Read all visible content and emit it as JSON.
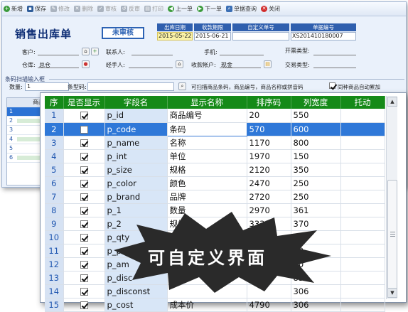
{
  "toolbar": {
    "items": [
      {
        "label": "新增",
        "icon": "add-icon",
        "enabled": true
      },
      {
        "label": "保存",
        "icon": "save-icon",
        "enabled": true
      },
      {
        "label": "修改",
        "icon": "edit-icon",
        "enabled": false
      },
      {
        "label": "删除",
        "icon": "delete-icon",
        "enabled": false
      },
      {
        "label": "审核",
        "icon": "approve-icon",
        "enabled": false
      },
      {
        "label": "反审",
        "icon": "unapprove-icon",
        "enabled": false
      },
      {
        "label": "打印",
        "icon": "print-icon",
        "enabled": false
      },
      {
        "label": "上一单",
        "icon": "prev-icon",
        "enabled": true
      },
      {
        "label": "下一单",
        "icon": "next-icon",
        "enabled": true
      },
      {
        "label": "单据查询",
        "icon": "query-icon",
        "enabled": true
      },
      {
        "label": "关闭",
        "icon": "close-icon",
        "enabled": true
      }
    ]
  },
  "doc": {
    "title": "销售出库单",
    "stamp": "未审核",
    "headers": [
      "出库日期",
      "收款期限",
      "自定义单号",
      "单据编号"
    ],
    "values": [
      "2015-05-22",
      "2015-06-21",
      "",
      "XS201410180007"
    ]
  },
  "form": {
    "customer": "客户:",
    "contact": "联系人:",
    "mobile": "手机:",
    "invoice_type": "开票类型:",
    "warehouse": "仓库:",
    "warehouse_value": "总仓",
    "handler": "经手人:",
    "account": "收款帐户:",
    "account_value": "现金",
    "trade_type": "交易类型:"
  },
  "scan": {
    "section": "条码扫描输入框",
    "qty_label": "数量:",
    "qty_value": "1",
    "barcode_label": "条型码:",
    "hint": "可扫描商品条码，商品编号，商品名称或拼音码",
    "same_merge": "同种商品自动累加"
  },
  "bg_grid": {
    "header": "商品",
    "rows": [
      "1",
      "2",
      "3",
      "4",
      "5",
      "6"
    ]
  },
  "table": {
    "columns": [
      "序",
      "是否显示",
      "字段名",
      "显示名称",
      "排序码",
      "列宽度",
      "托动"
    ],
    "rows": [
      {
        "seq": "1",
        "visible": true,
        "field": "p_id",
        "name": "商品编号",
        "sort": "20",
        "width": "550"
      },
      {
        "seq": "2",
        "visible": false,
        "field": "p_code",
        "name": "条码",
        "sort": "570",
        "width": "600"
      },
      {
        "seq": "3",
        "visible": true,
        "field": "p_name",
        "name": "名称",
        "sort": "1170",
        "width": "800"
      },
      {
        "seq": "4",
        "visible": true,
        "field": "p_int",
        "name": "单位",
        "sort": "1970",
        "width": "150"
      },
      {
        "seq": "5",
        "visible": true,
        "field": "p_size",
        "name": "规格",
        "sort": "2120",
        "width": "350"
      },
      {
        "seq": "6",
        "visible": true,
        "field": "p_color",
        "name": "颜色",
        "sort": "2470",
        "width": "250"
      },
      {
        "seq": "7",
        "visible": true,
        "field": "p_brand",
        "name": "品牌",
        "sort": "2720",
        "width": "250"
      },
      {
        "seq": "8",
        "visible": true,
        "field": "p_1",
        "name": "数量",
        "sort": "2970",
        "width": "361"
      },
      {
        "seq": "9",
        "visible": true,
        "field": "p_2",
        "name": "规格",
        "sort": "3331",
        "width": "370"
      },
      {
        "seq": "10",
        "visible": true,
        "field": "p_qty",
        "name": "",
        "sort": "",
        "width": "300"
      },
      {
        "seq": "11",
        "visible": true,
        "field": "p_pri",
        "name": "",
        "sort": "",
        "width": "00"
      },
      {
        "seq": "12",
        "visible": true,
        "field": "p_am",
        "name": "",
        "sort": "",
        "width": "00"
      },
      {
        "seq": "13",
        "visible": true,
        "field": "p_disc",
        "name": "",
        "sort": "",
        "width": "83"
      },
      {
        "seq": "14",
        "visible": true,
        "field": "p_disconst",
        "name": "",
        "sort": "",
        "width": "306"
      },
      {
        "seq": "15",
        "visible": true,
        "field": "p_cost",
        "name": "成本价",
        "sort": "4790",
        "width": "306"
      }
    ],
    "selected_index": 1
  },
  "banner": {
    "text": "可自定义界面",
    "color": "#2a2a2a"
  },
  "colors": {
    "header_green": "#158a18",
    "selection_blue": "#2f78d8",
    "title_navy": "#0f2f76"
  }
}
